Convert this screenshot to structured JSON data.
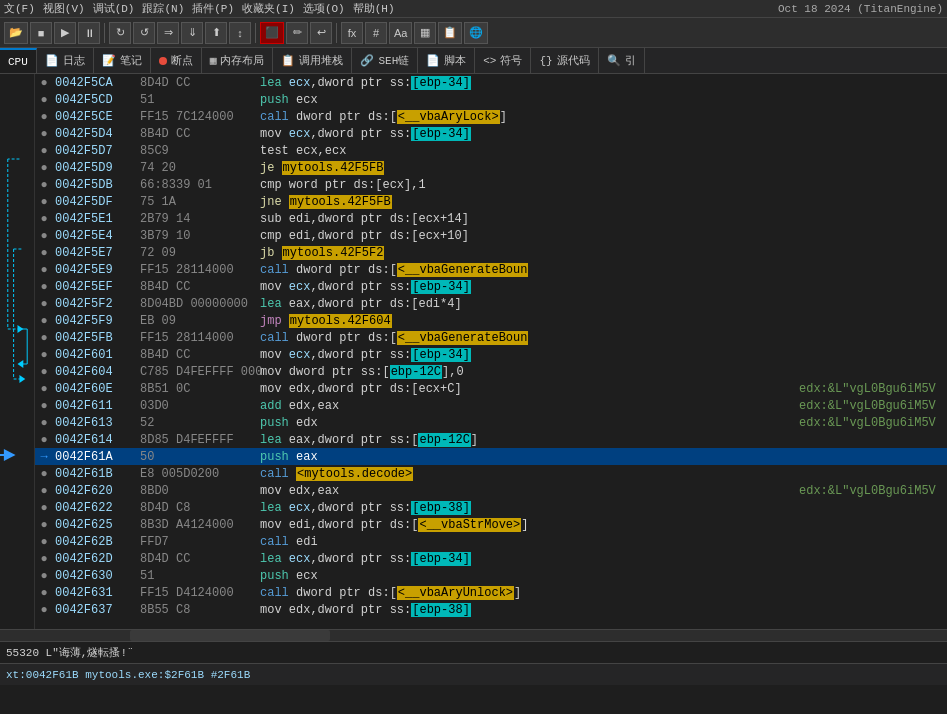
{
  "menubar": {
    "items": [
      "文(F)",
      "视图(V)",
      "调试(D)",
      "跟踪(N)",
      "插件(P)",
      "收藏夹(I)",
      "选项(O)",
      "帮助(H)"
    ],
    "datetime": "Oct 18 2024 (TitanEngine)"
  },
  "toolbar": {
    "buttons": [
      "▶",
      "■",
      "→",
      "⏸",
      "↻",
      "↺",
      "⇒",
      "⇓",
      "⬆",
      "↕",
      "⬛",
      "~",
      "fx",
      "#",
      "Aa",
      "▦",
      "⬜",
      "🌐"
    ]
  },
  "tabs": [
    {
      "id": "cpu",
      "label": "CPU",
      "icon": "",
      "active": true
    },
    {
      "id": "log",
      "label": "日志",
      "icon": "📄"
    },
    {
      "id": "notes",
      "label": "笔记",
      "icon": "📝"
    },
    {
      "id": "breakpoints",
      "label": "断点",
      "icon": "●",
      "dot": "red"
    },
    {
      "id": "memory",
      "label": "内存布局",
      "icon": "▦"
    },
    {
      "id": "callstack",
      "label": "调用堆栈",
      "icon": "📋"
    },
    {
      "id": "seh",
      "label": "SEH链",
      "icon": "🔗"
    },
    {
      "id": "script",
      "label": "脚本",
      "icon": "📄"
    },
    {
      "id": "symbol",
      "label": "符号",
      "icon": "<>"
    },
    {
      "id": "source",
      "label": "源代码",
      "icon": "{}"
    },
    {
      "id": "search",
      "label": "引",
      "icon": "🔍"
    }
  ],
  "disasm": {
    "rows": [
      {
        "addr": "0042F5CA",
        "bytes": "8D4D CC",
        "instr": "lea ecx,dword ptr ss:[ebp-34]",
        "comment": "",
        "bullet": true,
        "selected": false,
        "arrow": ""
      },
      {
        "addr": "0042F5CD",
        "bytes": "51",
        "instr": "push ecx",
        "comment": "",
        "bullet": true,
        "selected": false
      },
      {
        "addr": "0042F5CE",
        "bytes": "FF15 7C124000",
        "instr": "call dword ptr ds:[<__vbaAryLock>]",
        "comment": "",
        "bullet": true,
        "selected": false
      },
      {
        "addr": "0042F5D4",
        "bytes": "8B4D CC",
        "instr": "mov ecx,dword ptr ss:[ebp-34]",
        "comment": "",
        "bullet": true,
        "selected": false
      },
      {
        "addr": "0042F5D7",
        "bytes": "85C9",
        "instr": "test ecx,ecx",
        "comment": "",
        "bullet": true,
        "selected": false
      },
      {
        "addr": "0042F5D9",
        "bytes": "74 20",
        "instr": "je mytools.42F5FB",
        "comment": "",
        "bullet": true,
        "selected": false,
        "conditional": true
      },
      {
        "addr": "0042F5DB",
        "bytes": "66:8339 01",
        "instr": "cmp word ptr ds:[ecx],1",
        "comment": "",
        "bullet": true,
        "selected": false
      },
      {
        "addr": "0042F5DF",
        "bytes": "75 1A",
        "instr": "jne mytools.42F5FB",
        "comment": "",
        "bullet": true,
        "selected": false,
        "conditional": true
      },
      {
        "addr": "0042F5E1",
        "bytes": "2B79 14",
        "instr": "sub edi,dword ptr ds:[ecx+14]",
        "comment": "",
        "bullet": true,
        "selected": false
      },
      {
        "addr": "0042F5E4",
        "bytes": "3B79 10",
        "instr": "cmp edi,dword ptr ds:[ecx+10]",
        "comment": "",
        "bullet": true,
        "selected": false
      },
      {
        "addr": "0042F5E7",
        "bytes": "72 09",
        "instr": "jb mytools.42F5F2",
        "comment": "",
        "bullet": true,
        "selected": false,
        "conditional": true
      },
      {
        "addr": "0042F5E9",
        "bytes": "FF15 28114000",
        "instr": "call dword ptr ds:[<__vbaGenerateBoun",
        "comment": "",
        "bullet": true,
        "selected": false
      },
      {
        "addr": "0042F5EF",
        "bytes": "8B4D CC",
        "instr": "mov ecx,dword ptr ss:[ebp-34]",
        "comment": "",
        "bullet": true,
        "selected": false
      },
      {
        "addr": "0042F5F2",
        "bytes": "8D04BD 00000000",
        "instr": "lea eax,dword ptr ds:[edi*4]",
        "comment": "",
        "bullet": true,
        "selected": false
      },
      {
        "addr": "0042F5F9",
        "bytes": "EB 09",
        "instr": "jmp mytools.42F604",
        "comment": "",
        "bullet": true,
        "selected": false,
        "conditional": true
      },
      {
        "addr": "0042F5FB",
        "bytes": "FF15 28114000",
        "instr": "call dword ptr ds:[<__vbaGenerateBoun",
        "comment": "",
        "bullet": true,
        "selected": false
      },
      {
        "addr": "0042F601",
        "bytes": "8B4D CC",
        "instr": "mov ecx,dword ptr ss:[ebp-34]",
        "comment": "",
        "bullet": true,
        "selected": false
      },
      {
        "addr": "0042F604",
        "bytes": "C785 D4FEFFFF 000",
        "instr": "mov dword ptr ss:[ebp-12C],0",
        "comment": "",
        "bullet": true,
        "selected": false
      },
      {
        "addr": "0042F60E",
        "bytes": "8B51 0C",
        "instr": "mov edx,dword ptr ds:[ecx+C]",
        "comment": "edx:&L\"vgLOBgu6iM5V",
        "bullet": true,
        "selected": false
      },
      {
        "addr": "0042F611",
        "bytes": "03D0",
        "instr": "add edx,eax",
        "comment": "edx:&L\"vgLOBgu6iM5V",
        "bullet": true,
        "selected": false
      },
      {
        "addr": "0042F613",
        "bytes": "52",
        "instr": "push edx",
        "comment": "edx:&L\"vgLOBgu6iM5V",
        "bullet": true,
        "selected": false
      },
      {
        "addr": "0042F614",
        "bytes": "8D85 D4FEFFFF",
        "instr": "lea eax,dword ptr ss:[ebp-12C]",
        "comment": "",
        "bullet": true,
        "selected": false
      },
      {
        "addr": "0042F61A",
        "bytes": "50",
        "instr": "push eax",
        "comment": "",
        "bullet": true,
        "selected": true,
        "current_arrow": true
      },
      {
        "addr": "0042F61B",
        "bytes": "E8 005D0200",
        "instr": "call <mytools.decode>",
        "comment": "",
        "bullet": true,
        "selected": false
      },
      {
        "addr": "0042F620",
        "bytes": "8BD0",
        "instr": "mov edx,eax",
        "comment": "edx:&L\"vgLOBgu6iM5V",
        "bullet": true,
        "selected": false
      },
      {
        "addr": "0042F622",
        "bytes": "8D4D C8",
        "instr": "lea ecx,dword ptr ss:[ebp-38]",
        "comment": "",
        "bullet": true,
        "selected": false
      },
      {
        "addr": "0042F625",
        "bytes": "8B3D A4124000",
        "instr": "mov edi,dword ptr ds:[<__vbaStrMove>]",
        "comment": "",
        "bullet": true,
        "selected": false
      },
      {
        "addr": "0042F62B",
        "bytes": "FFD7",
        "instr": "call edi",
        "comment": "",
        "bullet": true,
        "selected": false
      },
      {
        "addr": "0042F62D",
        "bytes": "8D4D CC",
        "instr": "lea ecx,dword ptr ss:[ebp-34]",
        "comment": "",
        "bullet": true,
        "selected": false
      },
      {
        "addr": "0042F630",
        "bytes": "51",
        "instr": "push ecx",
        "comment": "",
        "bullet": true,
        "selected": false
      },
      {
        "addr": "0042F631",
        "bytes": "FF15 D4124000",
        "instr": "call dword ptr ds:[<__vbaAryUnlock>]",
        "comment": "",
        "bullet": true,
        "selected": false
      },
      {
        "addr": "0042F637",
        "bytes": "8B55 C8",
        "instr": "mov edx,dword ptr ss:[ebp-38]",
        "comment": "",
        "bullet": true,
        "selected": false
      }
    ]
  },
  "statusbar1": {
    "text": "55320 L\"诲薄,燧転搔!¨"
  },
  "statusbar2": {
    "text": "xt:0042F61B mytools.exe:$2F61B #2F61B"
  }
}
